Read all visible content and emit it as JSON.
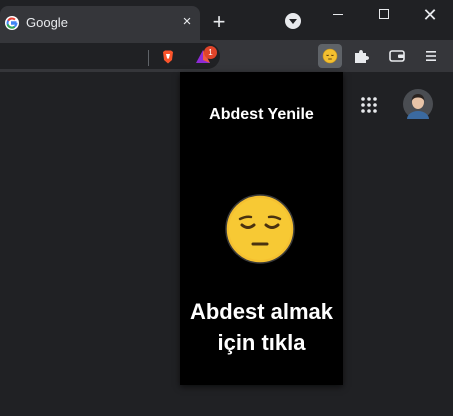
{
  "browser": {
    "tab": {
      "title": "Google",
      "favicon": "google-g-icon",
      "close": "×"
    },
    "new_tab": "+",
    "window_close": "✕",
    "toolbar": {
      "extension_badge": "1",
      "icons": [
        "brave-shields-icon",
        "brave-rewards-icon",
        "extension-emoji-icon",
        "puzzle-icon",
        "wallet-icon",
        "menu-icon"
      ]
    }
  },
  "page": {
    "icons": [
      "apps-grid-icon",
      "avatar"
    ]
  },
  "popup": {
    "title": "Abdest Yenile",
    "emoji": "pensive-face-icon",
    "cta": "Abdest almak için tıkla"
  },
  "colors": {
    "frame": "#202124",
    "toolbar": "#35363a",
    "popup_bg": "#000000",
    "emoji_yellow": "#f4c030",
    "badge": "#e0442a"
  }
}
